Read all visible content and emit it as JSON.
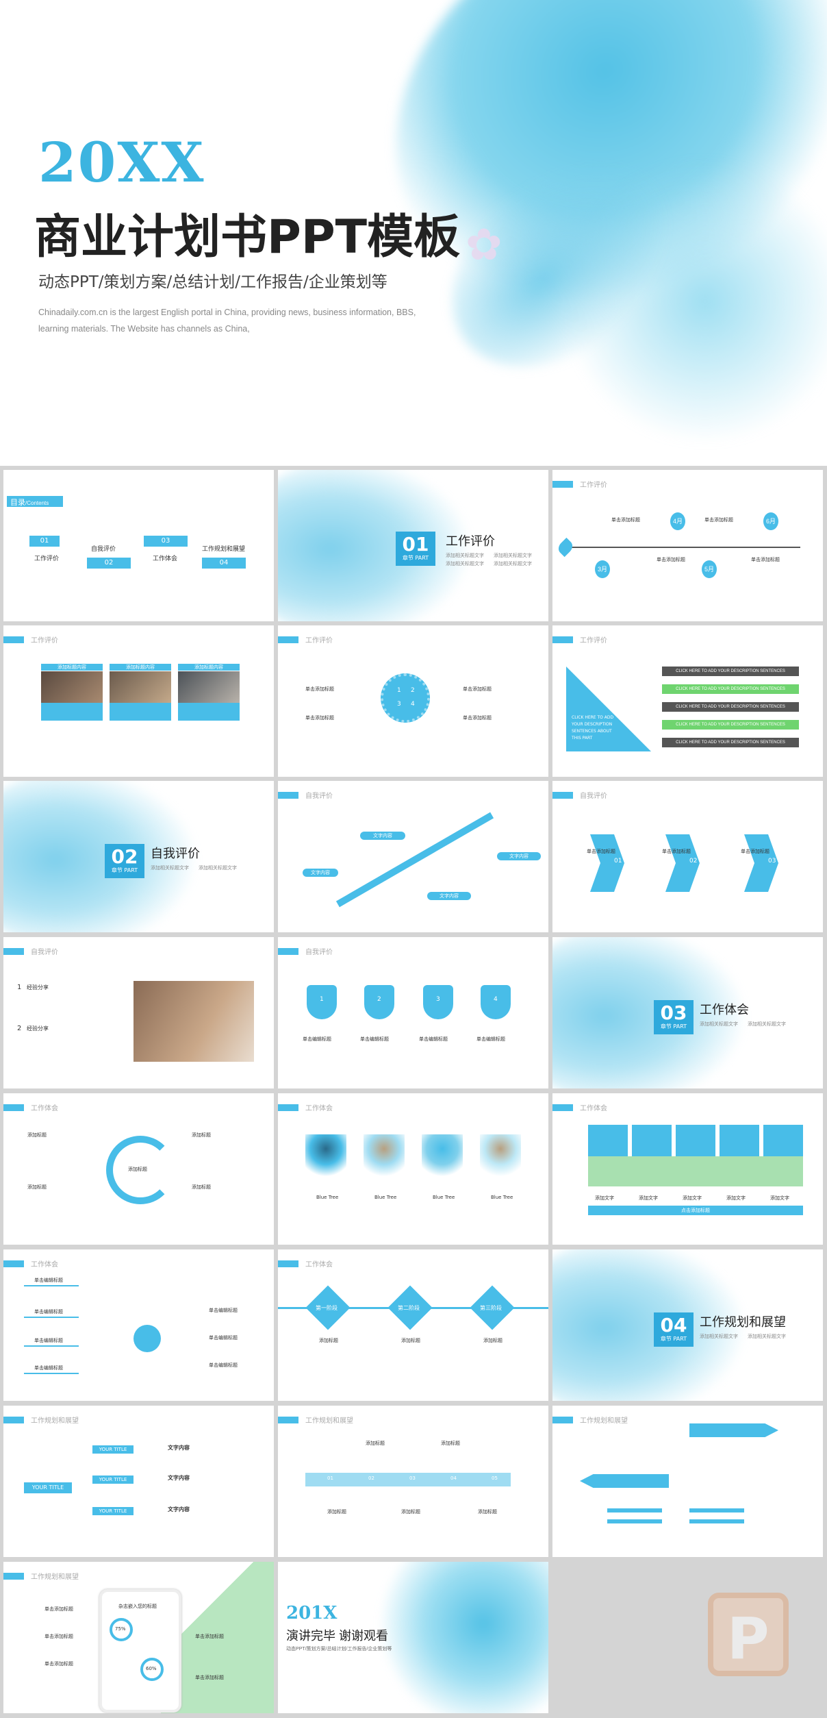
{
  "hero": {
    "year": "20XX",
    "title": "商业计划书PPT模板",
    "subtitle": "动态PPT/策划方案/总结计划/工作报告/企业策划等",
    "desc_line1": "Chinadaily.com.cn is the largest English portal in China, providing news, business information, BBS,",
    "desc_line2": "learning materials. The Website has channels as China,"
  },
  "toc": {
    "label": "目录",
    "label_en": "/Contents",
    "items": [
      {
        "num": "01",
        "label": "工作评价"
      },
      {
        "num": "02",
        "label": "自我评价"
      },
      {
        "num": "03",
        "label": "工作体会"
      },
      {
        "num": "04",
        "label": "工作规划和展望"
      }
    ]
  },
  "sections": [
    {
      "num": "01",
      "chapter": "章节 PART",
      "title": "工作评价"
    },
    {
      "num": "02",
      "chapter": "章节 PART",
      "title": "自我评价"
    },
    {
      "num": "03",
      "chapter": "章节 PART",
      "title": "工作体会"
    },
    {
      "num": "04",
      "chapter": "章节 PART",
      "title": "工作规划和展望"
    }
  ],
  "section_bullets": [
    "添加相关标题文字",
    "添加相关标题文字",
    "添加相关标题文字",
    "添加相关标题文字"
  ],
  "headers": {
    "gzpj": "工作评价",
    "zwpj": "自我评价",
    "gzth": "工作体会",
    "gzgh": "工作规划和展望"
  },
  "timeline": {
    "title": "单击添加标题",
    "months": [
      "3月",
      "4月",
      "5月",
      "6月"
    ]
  },
  "photos": {
    "headers": [
      "添加标题内容",
      "添加标题内容",
      "添加标题内容"
    ]
  },
  "circle": {
    "nums": [
      "1",
      "2",
      "3",
      "4"
    ],
    "title": "单击添加标题"
  },
  "triangle": {
    "left_text": "CLICK HERE TO ADD YOUR DESCRIPTION SENTENCES ABOUT THIS PART",
    "bar_text": "CLICK HERE TO ADD YOUR DESCRIPTION SENTENCES"
  },
  "arrows": {
    "labels": [
      "01",
      "02",
      "03"
    ],
    "title": "单击添加标题"
  },
  "experience": {
    "items": [
      {
        "num": "1",
        "label": "经验分享"
      },
      {
        "num": "2",
        "label": "经验分享"
      }
    ]
  },
  "trophies": {
    "nums": [
      "1",
      "2",
      "3",
      "4"
    ],
    "title": "单击编辑标题"
  },
  "cycle": {
    "center": "添加标题",
    "label": "添加标题"
  },
  "trees": {
    "label": "Blue Tree"
  },
  "cards": {
    "label": "添加文字",
    "bottom": "点击添加标题"
  },
  "mindmap": {
    "title": "单击编辑标题"
  },
  "diamonds": {
    "labels": [
      "第一阶段",
      "第二阶段",
      "第三阶段"
    ],
    "title": "添加标题"
  },
  "yourtitle": {
    "center": "YOUR TITLE",
    "branch": "YOUR TITLE",
    "right_title": "文字内容"
  },
  "chevrons": {
    "nums": [
      "01",
      "02",
      "03",
      "04",
      "05"
    ],
    "title": "添加标题"
  },
  "phone": {
    "heading": "杂志嵌入您的标题",
    "title": "单击添加标题",
    "pct1": "75%",
    "pct2": "60%"
  },
  "thanks": {
    "year": "201X",
    "title": "演讲完毕 谢谢观看",
    "subtitle": "动态PPT/策划方案/总结计划/工作报告/企业策划等"
  },
  "colors": {
    "accent": "#48bde8",
    "accent_dark": "#2ea9dc",
    "green": "#a8e0b0",
    "gray_bg": "#d4d4d4"
  }
}
